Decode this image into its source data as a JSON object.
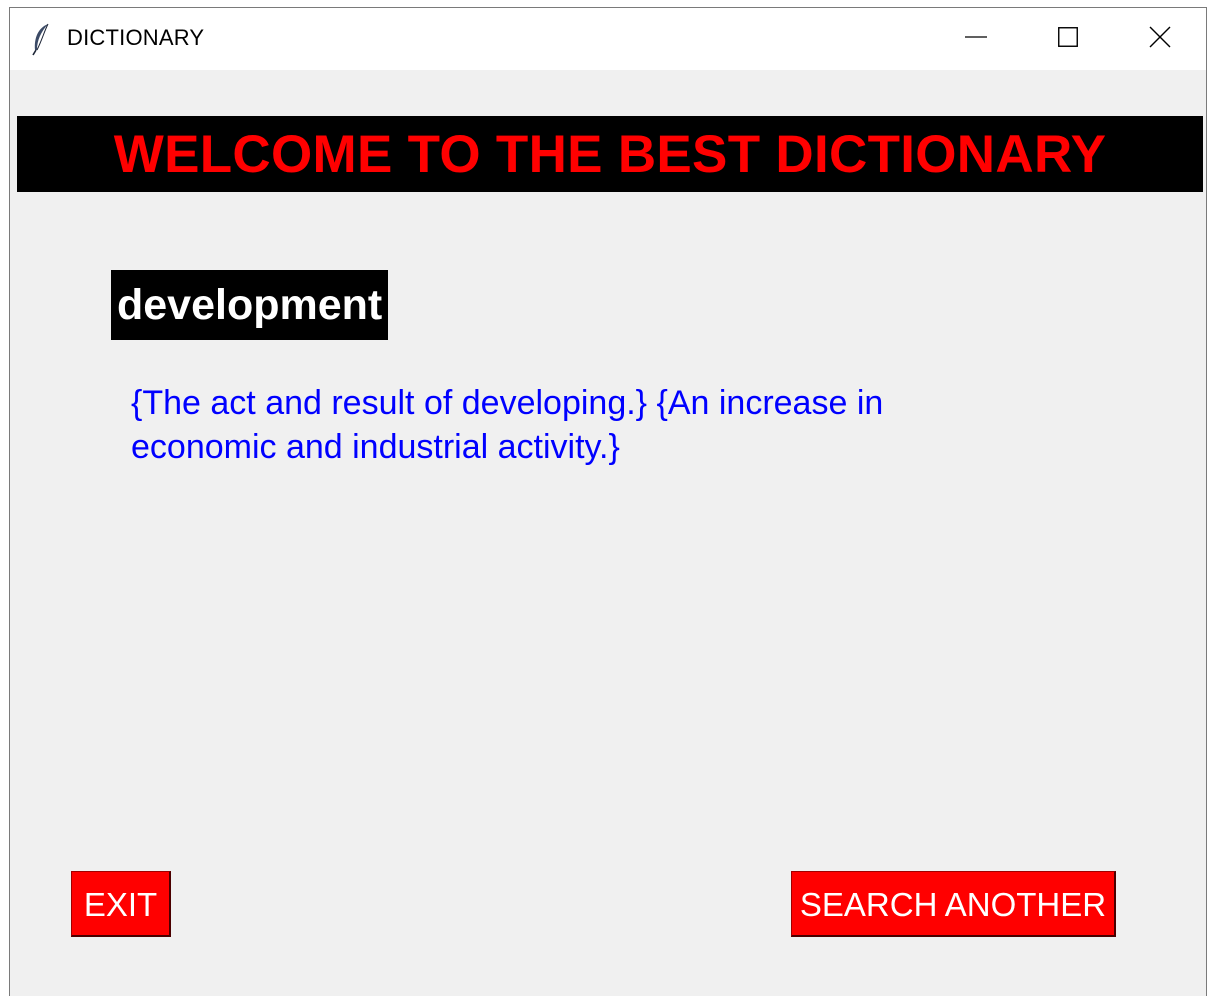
{
  "window": {
    "title": "DICTIONARY",
    "icon": "feather-icon",
    "controls": {
      "minimize_icon": "minimize-icon",
      "maximize_icon": "maximize-icon",
      "close_icon": "close-icon"
    }
  },
  "banner": {
    "text": "WELCOME TO THE BEST DICTIONARY"
  },
  "entry": {
    "word": "development",
    "definition": "{The act and result of developing.} {An increase in economic and industrial activity.}"
  },
  "buttons": {
    "exit_label": "EXIT",
    "search_another_label": "SEARCH ANOTHER"
  },
  "colors": {
    "banner_background": "#000000",
    "banner_text": "#ff0000",
    "word_background": "#000000",
    "word_text": "#ffffff",
    "definition_text": "#0000ff",
    "button_background": "#ff0000",
    "button_text": "#ffffff",
    "window_background": "#f0f0f0"
  }
}
